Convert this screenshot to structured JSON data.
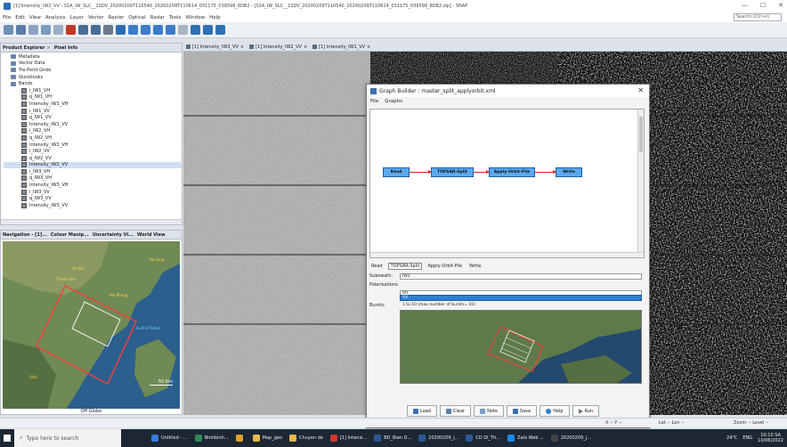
{
  "window": {
    "title": "[1] Intensity_IW2_VV - S1A_IW_SLC__1SDV_20200209T110540_20200209T110614_031175_039598_8DB2 - [S1A_IW_SLC__1SDV_20200209T110540_20200209T110614_031175_039598_8DB2.zip] - SNAP",
    "controls": [
      "—",
      "☐",
      "✕"
    ]
  },
  "menu": [
    "File",
    "Edit",
    "View",
    "Analysis",
    "Layer",
    "Vector",
    "Raster",
    "Optical",
    "Radar",
    "Tools",
    "Window",
    "Help"
  ],
  "search": {
    "placeholder": "Search (Ctrl+I)"
  },
  "toolbar": {
    "icons": [
      "open-product-icon",
      "save-icon",
      "graph-icon",
      "batch-icon",
      "band-maths-icon",
      "pin-icon",
      "zoom-in-icon",
      "zoom-out-icon",
      "pan-icon",
      "select-icon",
      "line-icon",
      "polygon-icon",
      "ellipse-icon",
      "rectangle-icon",
      "range-icon",
      "layout-1-icon",
      "layout-2-icon",
      "layout-3-icon"
    ]
  },
  "product_explorer": {
    "tabs": [
      "Product Explorer",
      "Pixel Info"
    ],
    "items": [
      {
        "label": "Metadata",
        "kind": "folder",
        "depth": 1
      },
      {
        "label": "Vector Data",
        "kind": "folder",
        "depth": 1
      },
      {
        "label": "Tie-Point Grids",
        "kind": "folder",
        "depth": 1
      },
      {
        "label": "Quicklooks",
        "kind": "folder",
        "depth": 1
      },
      {
        "label": "Bands",
        "kind": "folder",
        "depth": 1
      },
      {
        "label": "i_IW1_VH",
        "kind": "band",
        "depth": 2
      },
      {
        "label": "q_IW1_VH",
        "kind": "band",
        "depth": 2
      },
      {
        "label": "Intensity_IW1_VH",
        "kind": "band",
        "depth": 2
      },
      {
        "label": "i_IW1_VV",
        "kind": "band",
        "depth": 2
      },
      {
        "label": "q_IW1_VV",
        "kind": "band",
        "depth": 2
      },
      {
        "label": "Intensity_IW1_VV",
        "kind": "band",
        "depth": 2
      },
      {
        "label": "i_IW2_VH",
        "kind": "band",
        "depth": 2
      },
      {
        "label": "q_IW2_VH",
        "kind": "band",
        "depth": 2
      },
      {
        "label": "Intensity_IW2_VH",
        "kind": "band",
        "depth": 2
      },
      {
        "label": "i_IW2_VV",
        "kind": "band",
        "depth": 2
      },
      {
        "label": "q_IW2_VV",
        "kind": "band",
        "depth": 2
      },
      {
        "label": "Intensity_IW2_VV",
        "kind": "band",
        "depth": 2,
        "selected": true
      },
      {
        "label": "i_IW3_VH",
        "kind": "band",
        "depth": 2
      },
      {
        "label": "q_IW3_VH",
        "kind": "band",
        "depth": 2
      },
      {
        "label": "Intensity_IW3_VH",
        "kind": "band",
        "depth": 2
      },
      {
        "label": "i_IW3_VV",
        "kind": "band",
        "depth": 2
      },
      {
        "label": "q_IW3_VV",
        "kind": "band",
        "depth": 2
      },
      {
        "label": "Intensity_IW3_VV",
        "kind": "band",
        "depth": 2
      }
    ]
  },
  "world_view": {
    "tabs": [
      "Navigation - [1]...",
      "Colour Manip...",
      "Uncertainty Vi...",
      "World View"
    ],
    "places": [
      {
        "name": "Ha Noi"
      },
      {
        "name": "Hai Phong"
      },
      {
        "name": "Ha Long"
      },
      {
        "name": "Gulf of Tonkin"
      },
      {
        "name": "Thanh Hoa"
      },
      {
        "name": "Vinh"
      }
    ],
    "scale": "50 Km",
    "globe_label": "Off Globe"
  },
  "image_tabs": [
    "[1] Intensity_IW3_VV",
    "[1] Intensity_IW2_VV",
    "[1] Intensity_IW1_VV"
  ],
  "graph_builder": {
    "title": "Graph Builder : master_split_applyorbit.xml",
    "menu": [
      "File",
      "Graphs"
    ],
    "nodes": [
      {
        "label": "Read"
      },
      {
        "label": "TOPSAR-Split"
      },
      {
        "label": "Apply-Orbit-File"
      },
      {
        "label": "Write"
      }
    ],
    "op_tabs": [
      "Read",
      "TOPSAR-Split",
      "Apply-Orbit-File",
      "Write"
    ],
    "active_op_tab": "TOPSAR-Split",
    "params": {
      "subswath_label": "Subswath:",
      "subswath_value": "IW2",
      "polarisations_label": "Polarisations:",
      "polarisations_options": [
        "VH",
        "VV"
      ],
      "polarisations_selected": "VV",
      "bursts_label": "Bursts:",
      "bursts_value": "1 to 10 (max number of bursts= 10)"
    },
    "buttons": [
      "Load",
      "Clear",
      "Note",
      "Save",
      "Help",
      "Run"
    ]
  },
  "statusbar": {
    "x": "X -- Y --",
    "lat": "Lat -- Lon --",
    "zoom": "Zoom -- Level --"
  },
  "taskbar": {
    "search_placeholder": "Type here to search",
    "apps": [
      {
        "label": "Untitled - ...",
        "color": "#3a7bd5"
      },
      {
        "label": "Ninhbinh...",
        "color": "#2e8b57"
      },
      {
        "label": "",
        "color": "#e0a030"
      },
      {
        "label": "Map_geo",
        "color": "#e8b84a"
      },
      {
        "label": "Chuyen de",
        "color": "#e8b84a"
      },
      {
        "label": "[1] Intensi...",
        "color": "#d0392b"
      },
      {
        "label": "BD_Bien D...",
        "color": "#2b5797"
      },
      {
        "label": "20200209_j...",
        "color": "#2b5797"
      },
      {
        "label": "CD Di_Th...",
        "color": "#2b5797"
      },
      {
        "label": "Zalo Web ...",
        "color": "#1e88e5"
      },
      {
        "label": "20200209_j...",
        "color": "#444"
      }
    ],
    "weather": "24°C",
    "lang": "ENG",
    "time": "10:10 SA",
    "date": "10/06/2022"
  }
}
